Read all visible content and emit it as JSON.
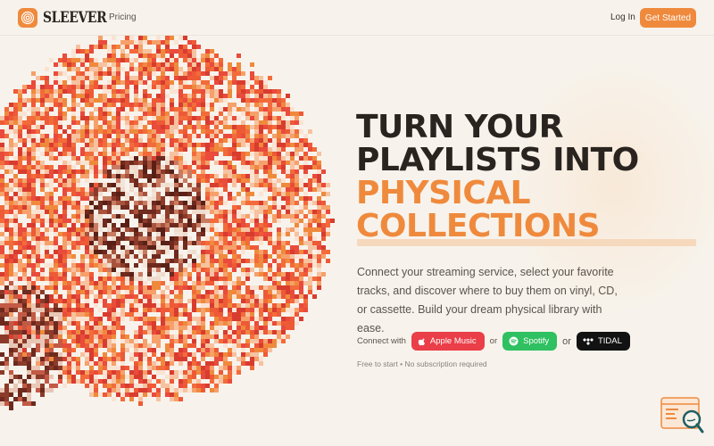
{
  "header": {
    "brand": "SLEEVER",
    "nav_pricing": "Pricing",
    "login": "Log In",
    "cta": "Get Started"
  },
  "hero": {
    "headline_lines": [
      {
        "text": "TURN YOUR",
        "color": "#2a2420"
      },
      {
        "text": "PLAYLISTS INTO",
        "color": "#2a2420"
      },
      {
        "text": "PHYSICAL",
        "color": "#ef8a3d"
      },
      {
        "text": "COLLECTIONS",
        "color": "#ef8a3d"
      }
    ],
    "description": "Connect your streaming service, select your favorite tracks, and discover where to buy them on vinyl, CD, or cassette. Build your dream physical library with ease.",
    "connect_label": "Connect with",
    "services": [
      {
        "label": "Apple Music",
        "icon": "apple-icon",
        "color": "#ea3e48"
      },
      {
        "label": "Spotify",
        "icon": "spotify-icon",
        "color": "#2fc061"
      },
      {
        "label": "TIDAL",
        "icon": "tidal-icon",
        "color": "#121212"
      }
    ],
    "or_label": "or",
    "footnote": "Free to start • No subscription required"
  },
  "colors": {
    "accent": "#ef8a3d",
    "background": "#f7f3ec",
    "text_dark": "#2a2420"
  }
}
